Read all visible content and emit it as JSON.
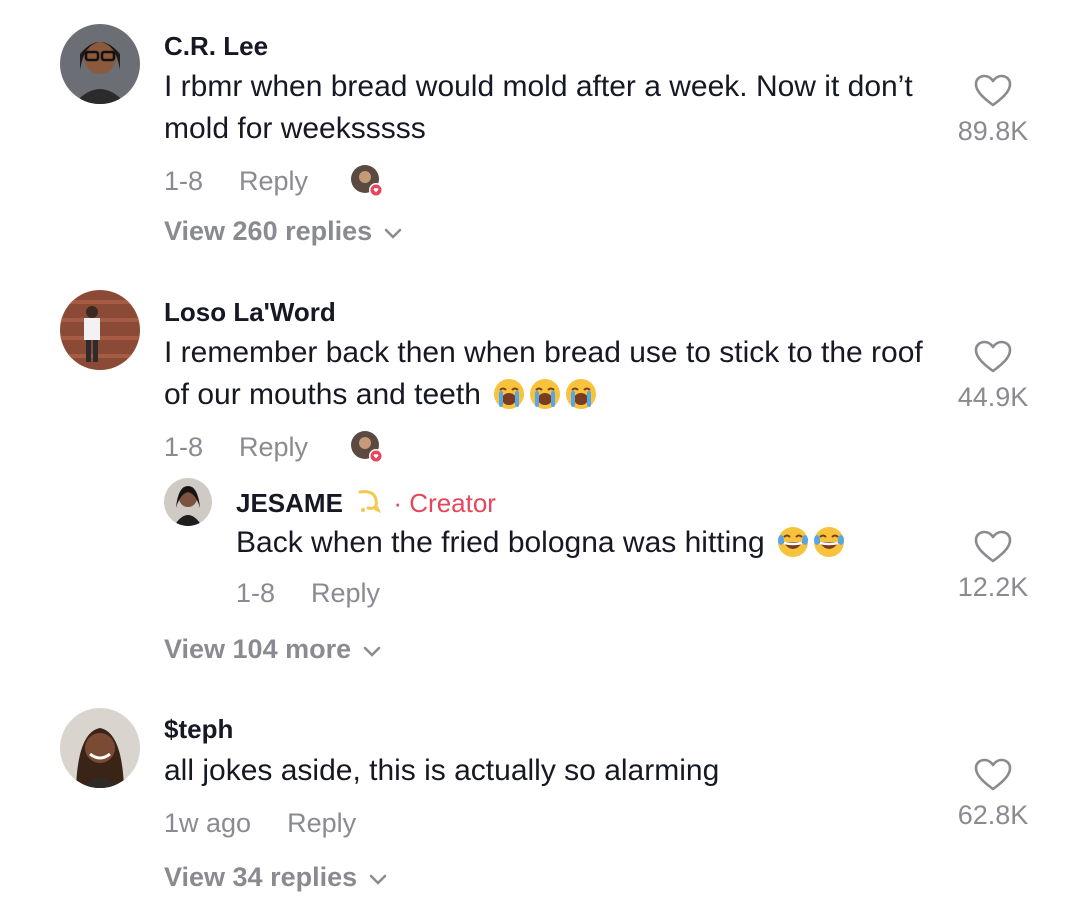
{
  "comments": [
    {
      "username": "C.R. Lee",
      "text": "I rbmr when bread would mold after a week. Now it don’t mold for weeksssss",
      "time": "1-8",
      "reply_label": "Reply",
      "likes": "89.8K",
      "view_replies": "View 260 replies"
    },
    {
      "username": "Loso La'Word",
      "text": "I remember back then when bread use to stick to the roof of our mouths and teeth",
      "time": "1-8",
      "reply_label": "Reply",
      "likes": "44.9K",
      "reply": {
        "username": "JESAME",
        "creator_label": "· Creator",
        "text": "Back when the fried bologna was hitting",
        "time": "1-8",
        "reply_label": "Reply",
        "likes": "12.2K"
      },
      "view_more": "View 104 more"
    },
    {
      "username": "$teph",
      "text": "all jokes aside, this is actually so alarming",
      "time": "1w ago",
      "reply_label": "Reply",
      "likes": "62.8K",
      "view_replies": "View 34 replies"
    }
  ],
  "icons": {
    "like": "heart-outline-icon",
    "creator_liked": "creator-liked-avatar-icon",
    "expand": "chevron-down-icon",
    "crying": "loudly-crying-face-emoji",
    "laughing": "tears-of-joy-emoji",
    "dizzy": "dizzy-emoji"
  },
  "colors": {
    "text": "#161823",
    "secondary": "#8a8b91",
    "creator": "#e5475a"
  }
}
